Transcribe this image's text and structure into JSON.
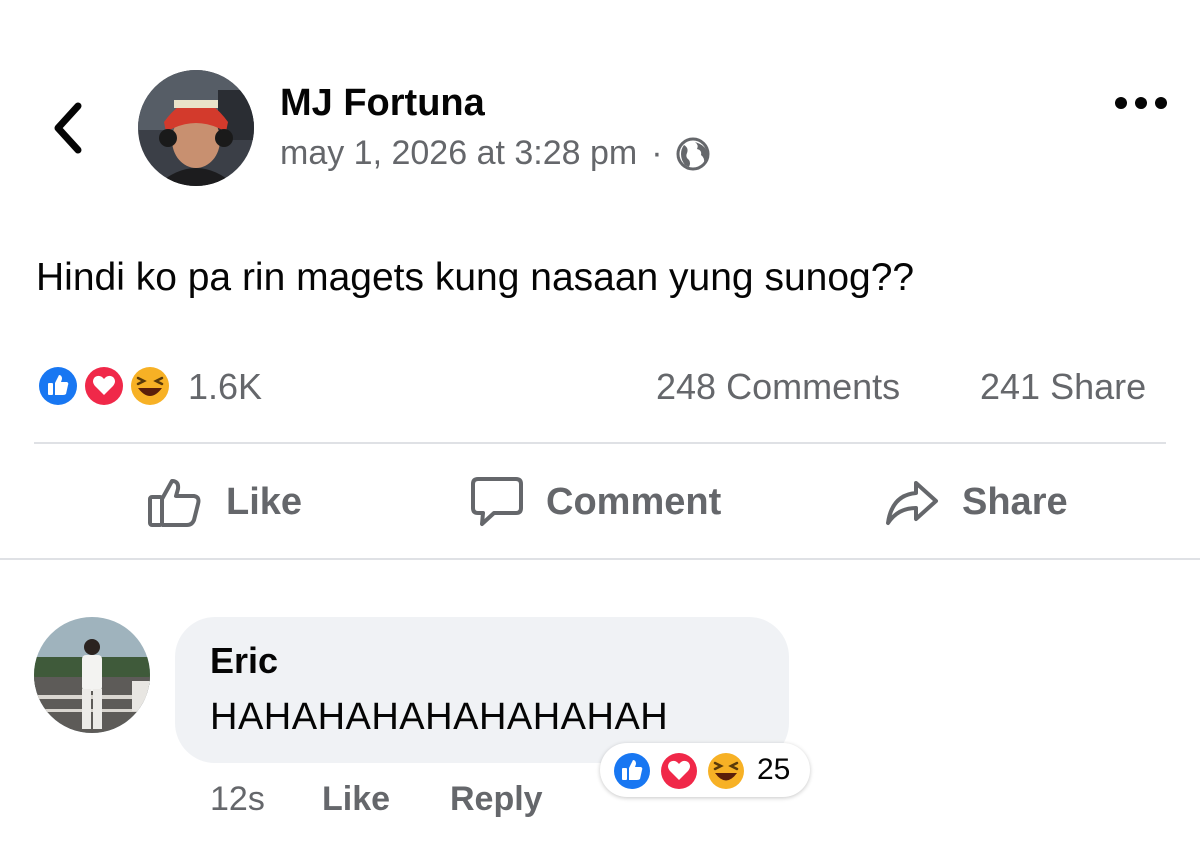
{
  "post": {
    "author": "MJ Fortuna",
    "timestamp": "may 1, 2026 at 3:28 pm",
    "separator": "·",
    "audience_icon": "globe-icon",
    "text": "Hindi ko pa rin magets kung nasaan yung sunog??",
    "reactions": {
      "types": [
        "like",
        "love",
        "haha"
      ],
      "count": "1.6K"
    },
    "comments_count": "248 Comments",
    "shares_count": "241 Share"
  },
  "actions": {
    "like": "Like",
    "comment": "Comment",
    "share": "Share"
  },
  "comment": {
    "author": "Eric",
    "text": "HAHAHAHAHAHAHAHAH",
    "time": "12s",
    "like": "Like",
    "reply": "Reply",
    "reactions": {
      "types": [
        "like",
        "love",
        "haha"
      ],
      "count": "25"
    }
  },
  "colors": {
    "text": "#050505",
    "secondary": "#65676b",
    "like_blue": "#1877f2",
    "love_red": "#f02849",
    "haha_yellow": "#f7b125",
    "bubble": "#f0f2f5",
    "divider": "#dfe1e5"
  }
}
